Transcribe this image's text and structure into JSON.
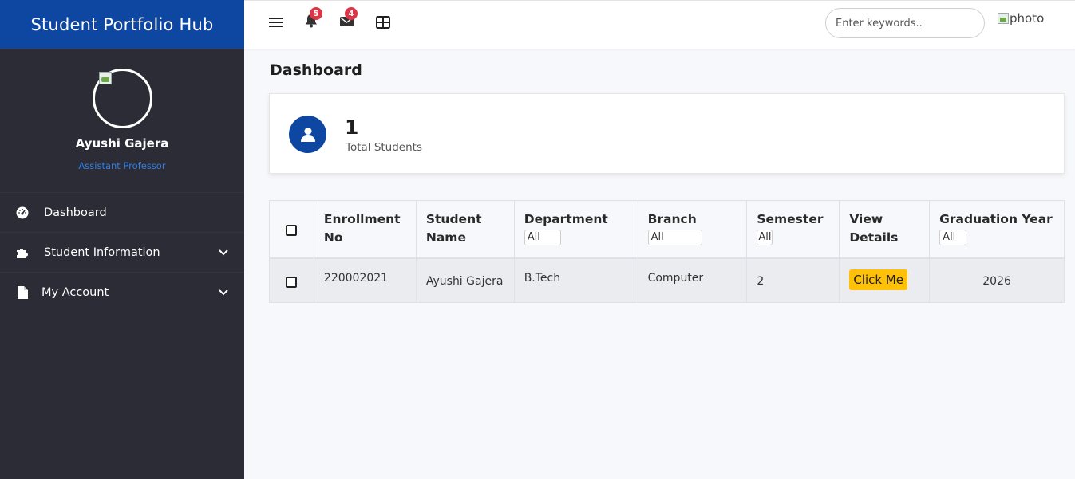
{
  "brand": {
    "title": "Student Portfolio Hub"
  },
  "profile": {
    "name": "Ayushi Gajera",
    "role": "Assistant Professor",
    "avatar_icon": "avatar-image-placeholder"
  },
  "sidebar": {
    "items": [
      {
        "label": "Dashboard",
        "icon": "dashboard-icon"
      },
      {
        "label": "Student Information",
        "icon": "puzzle-icon",
        "expandable": true
      },
      {
        "label": "My Account",
        "icon": "file-icon",
        "expandable": true
      }
    ]
  },
  "topbar": {
    "notifications_count": "5",
    "messages_count": "4",
    "search_placeholder": "Enter keywords..",
    "photo_alt": "photo"
  },
  "page": {
    "title": "Dashboard"
  },
  "stat": {
    "value": "1",
    "label": "Total Students"
  },
  "table": {
    "headers": {
      "enrollment": "Enrollment No",
      "student_name": "Student Name",
      "department": "Department",
      "branch": "Branch",
      "semester": "Semester",
      "view_details": "View Details",
      "graduation_year": "Graduation Year"
    },
    "filters": {
      "department": "All",
      "branch": "All",
      "semester": "All",
      "graduation_year": "All"
    },
    "rows": [
      {
        "enrollment": "220002021",
        "student_name": "Ayushi Gajera",
        "department": "B.Tech",
        "branch": "Computer",
        "semester": "2",
        "view_details": "Click Me",
        "graduation_year": "2026"
      }
    ]
  },
  "colors": {
    "brand": "#0d47a1",
    "sidebar": "#2b2c35",
    "accent_button": "#ffc107",
    "badge": "#dc3545",
    "role_text": "#2f7fe8"
  }
}
